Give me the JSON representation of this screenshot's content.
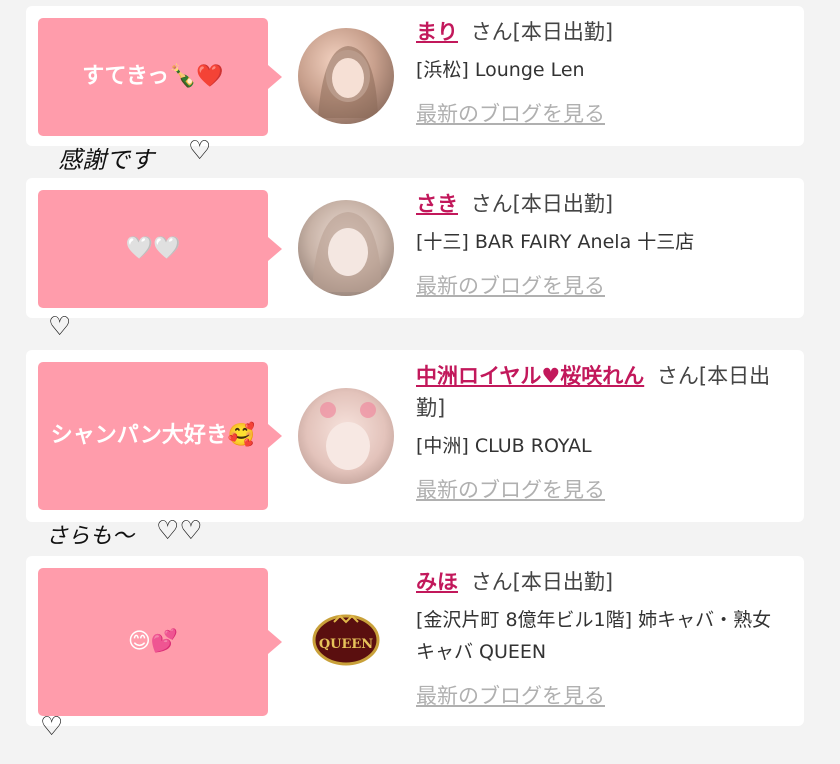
{
  "cards": [
    {
      "bubble_text": "すてきっ🍾❤️",
      "name": "まり",
      "suffix": "さん[本日出勤]",
      "shop": "[浜松] Lounge Len",
      "blog": "最新のブログを見る",
      "avatar_icon": "woman-photo-avatar"
    },
    {
      "bubble_text": "🤍🤍",
      "name": "さき",
      "suffix": "さん[本日出勤]",
      "shop": "[十三] BAR FAIRY Anela 十三店",
      "blog": "最新のブログを見る",
      "avatar_icon": "woman-photo-avatar"
    },
    {
      "bubble_text": "シャンパン大好き🥰",
      "name": "中洲ロイヤル♥桜咲れん",
      "suffix": "さん[本日出勤]",
      "shop": "[中洲] CLUB ROYAL",
      "blog": "最新のブログを見る",
      "avatar_icon": "woman-photo-avatar"
    },
    {
      "bubble_text": "😊💕",
      "name": "みほ",
      "suffix": "さん[本日出勤]",
      "shop": "[金沢片町 8億年ビル1階] 姉キャバ・熟女キャバ QUEEN",
      "blog": "最新のブログを見る",
      "avatar_icon": "queen-logo",
      "logo_text": "QUEEN"
    }
  ],
  "doodles": {
    "first": "感謝です",
    "second": "さらも～"
  },
  "colors": {
    "bubble": "#ff9cab",
    "name": "#c2185b",
    "link": "#b0b0b0",
    "background": "#f3f3f3"
  }
}
